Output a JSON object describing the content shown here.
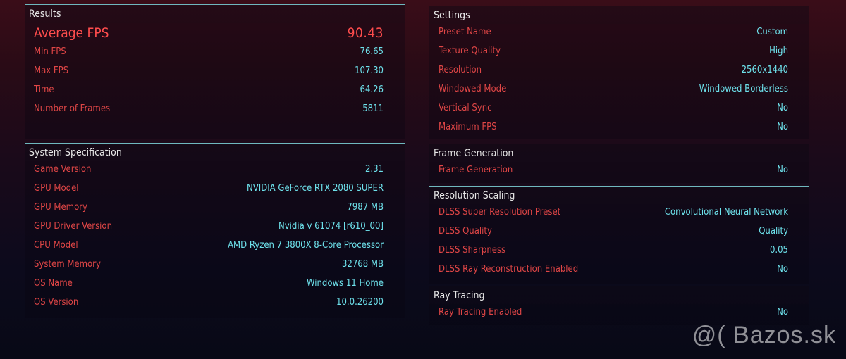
{
  "results": {
    "title": "Results",
    "average_fps": {
      "label": "Average FPS",
      "value": "90.43"
    },
    "rows": [
      {
        "label": "Min FPS",
        "value": "76.65"
      },
      {
        "label": "Max FPS",
        "value": "107.30"
      },
      {
        "label": "Time",
        "value": "64.26"
      },
      {
        "label": "Number of Frames",
        "value": "5811"
      }
    ]
  },
  "system": {
    "title": "System Specification",
    "rows": [
      {
        "label": "Game Version",
        "value": "2.31"
      },
      {
        "label": "GPU Model",
        "value": "NVIDIA GeForce RTX 2080 SUPER"
      },
      {
        "label": "GPU Memory",
        "value": "7987 MB"
      },
      {
        "label": "GPU Driver Version",
        "value": "Nvidia v 61074 [r610_00]"
      },
      {
        "label": "CPU Model",
        "value": "AMD Ryzen 7 3800X 8-Core Processor"
      },
      {
        "label": "System Memory",
        "value": "32768 MB"
      },
      {
        "label": "OS Name",
        "value": "Windows 11 Home"
      },
      {
        "label": "OS Version",
        "value": "10.0.26200"
      }
    ]
  },
  "settings": {
    "title": "Settings",
    "rows": [
      {
        "label": "Preset Name",
        "value": "Custom"
      },
      {
        "label": "Texture Quality",
        "value": "High"
      },
      {
        "label": "Resolution",
        "value": "2560x1440"
      },
      {
        "label": "Windowed Mode",
        "value": "Windowed Borderless"
      },
      {
        "label": "Vertical Sync",
        "value": "No"
      },
      {
        "label": "Maximum FPS",
        "value": "No"
      }
    ]
  },
  "frame_generation": {
    "title": "Frame Generation",
    "rows": [
      {
        "label": "Frame Generation",
        "value": "No"
      }
    ]
  },
  "resolution_scaling": {
    "title": "Resolution Scaling",
    "rows": [
      {
        "label": "DLSS Super Resolution Preset",
        "value": "Convolutional Neural Network"
      },
      {
        "label": "DLSS Quality",
        "value": "Quality"
      },
      {
        "label": "DLSS Sharpness",
        "value": "0.05"
      },
      {
        "label": "DLSS Ray Reconstruction Enabled",
        "value": "No"
      }
    ]
  },
  "ray_tracing": {
    "title": "Ray Tracing",
    "rows": [
      {
        "label": "Ray Tracing Enabled",
        "value": "No"
      }
    ]
  },
  "watermark": "@( Bazos.sk",
  "colors": {
    "label_red": "#e04646",
    "value_cyan": "#6ee2ec",
    "accent_line": "#6fb8be",
    "header_text": "#e6e6e6"
  }
}
